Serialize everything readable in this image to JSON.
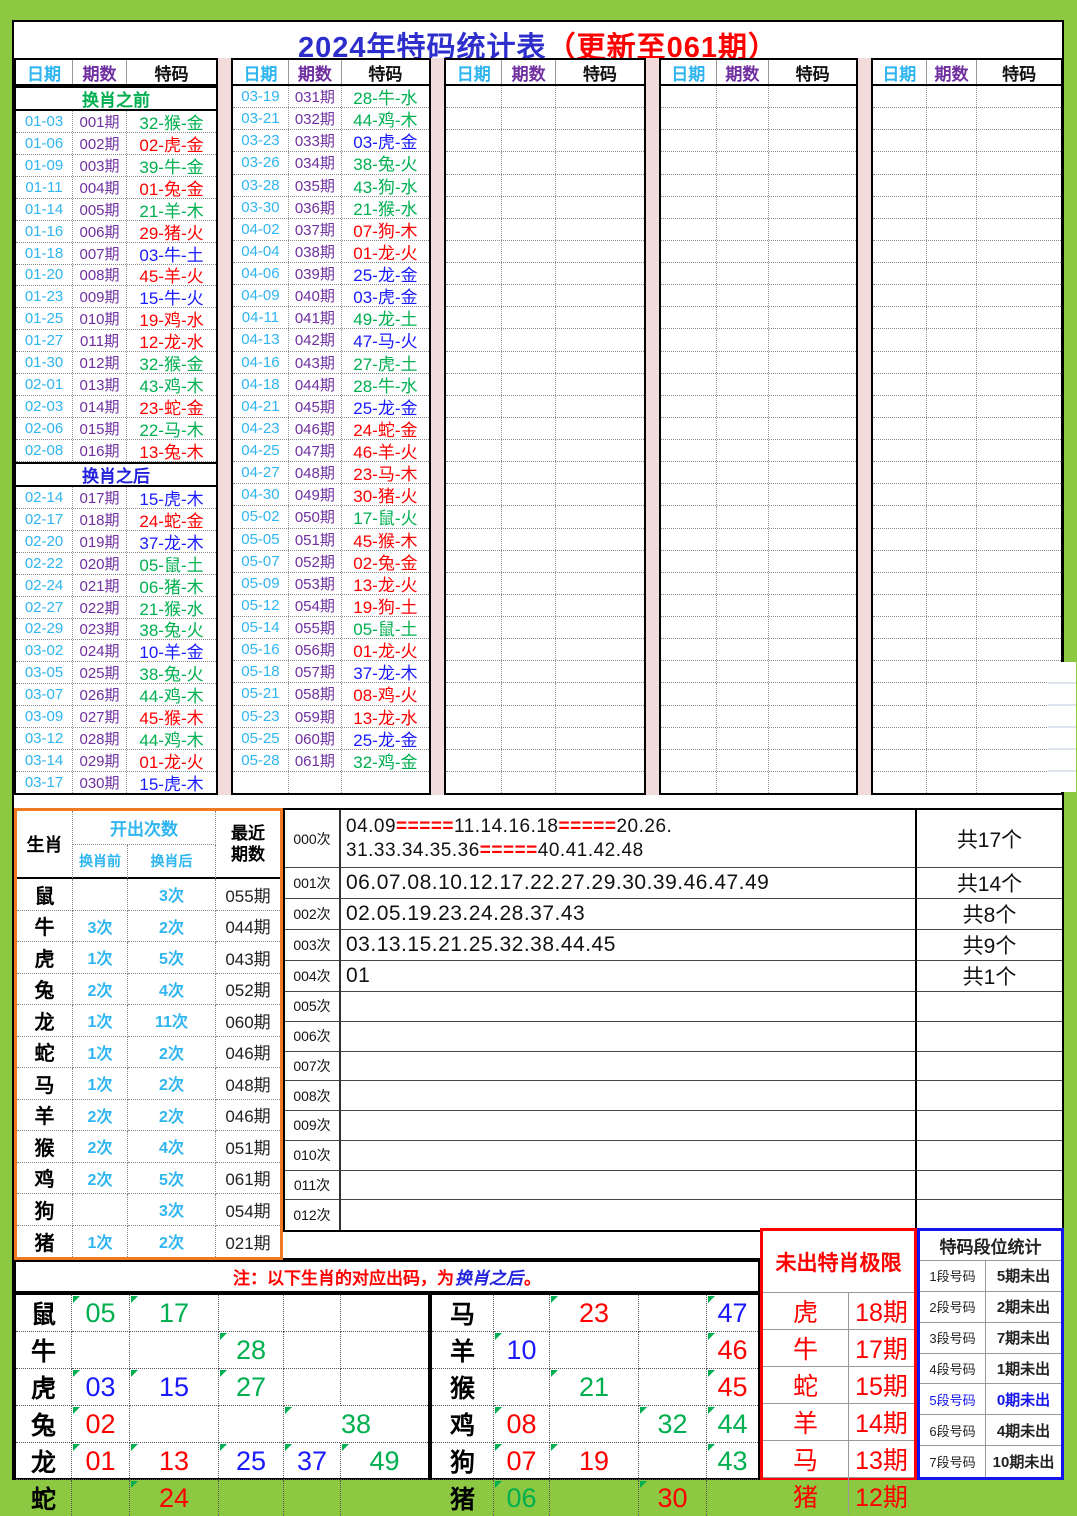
{
  "title": {
    "main": "2024年特码统计表",
    "suffix": "（更新至061期）"
  },
  "wave": {
    "red": [
      "01",
      "02",
      "07",
      "08",
      "12",
      "13",
      "18",
      "19",
      "23",
      "24",
      "29",
      "30",
      "34",
      "35",
      "40",
      "45",
      "46"
    ],
    "blue": [
      "03",
      "04",
      "09",
      "10",
      "14",
      "15",
      "20",
      "25",
      "26",
      "31",
      "36",
      "37",
      "41",
      "42",
      "47",
      "48"
    ],
    "green": [
      "05",
      "06",
      "11",
      "16",
      "17",
      "21",
      "22",
      "27",
      "28",
      "32",
      "33",
      "38",
      "39",
      "43",
      "44",
      "49"
    ]
  },
  "colors": {
    "accent_red": "#FE0000",
    "accent_blue": "#1A1AFF",
    "accent_green": "#00B050",
    "cyan": "#2FB5F0",
    "purple": "#7030A0",
    "orange": "#EE7B22",
    "pink_separator": "#F2DCDB",
    "frame_green": "#8DC843"
  },
  "top_table": {
    "headers": {
      "date": "日期",
      "period": "期数",
      "code": "特码"
    },
    "groups": [
      {
        "rows": [
          {
            "s": "换肖之前",
            "c": "green"
          },
          {
            "d": "01-03",
            "p": "001期",
            "code": "32-猴-金"
          },
          {
            "d": "01-06",
            "p": "002期",
            "code": "02-虎-金"
          },
          {
            "d": "01-09",
            "p": "003期",
            "code": "39-牛-金"
          },
          {
            "d": "01-11",
            "p": "004期",
            "code": "01-兔-金"
          },
          {
            "d": "01-14",
            "p": "005期",
            "code": "21-羊-木"
          },
          {
            "d": "01-16",
            "p": "006期",
            "code": "29-猪-火"
          },
          {
            "d": "01-18",
            "p": "007期",
            "code": "03-牛-土"
          },
          {
            "d": "01-20",
            "p": "008期",
            "code": "45-羊-火"
          },
          {
            "d": "01-23",
            "p": "009期",
            "code": "15-牛-火"
          },
          {
            "d": "01-25",
            "p": "010期",
            "code": "19-鸡-水"
          },
          {
            "d": "01-27",
            "p": "011期",
            "code": "12-龙-水"
          },
          {
            "d": "01-30",
            "p": "012期",
            "code": "32-猴-金"
          },
          {
            "d": "02-01",
            "p": "013期",
            "code": "43-鸡-木"
          },
          {
            "d": "02-03",
            "p": "014期",
            "code": "23-蛇-金"
          },
          {
            "d": "02-06",
            "p": "015期",
            "code": "22-马-木"
          },
          {
            "d": "02-08",
            "p": "016期",
            "code": "13-兔-木"
          },
          {
            "s": "换肖之后",
            "c": "blue"
          },
          {
            "d": "02-14",
            "p": "017期",
            "code": "15-虎-木"
          },
          {
            "d": "02-17",
            "p": "018期",
            "code": "24-蛇-金"
          },
          {
            "d": "02-20",
            "p": "019期",
            "code": "37-龙-木"
          },
          {
            "d": "02-22",
            "p": "020期",
            "code": "05-鼠-土"
          },
          {
            "d": "02-24",
            "p": "021期",
            "code": "06-猪-木"
          },
          {
            "d": "02-27",
            "p": "022期",
            "code": "21-猴-水"
          },
          {
            "d": "02-29",
            "p": "023期",
            "code": "38-兔-火"
          },
          {
            "d": "03-02",
            "p": "024期",
            "code": "10-羊-金"
          },
          {
            "d": "03-05",
            "p": "025期",
            "code": "38-兔-火"
          },
          {
            "d": "03-07",
            "p": "026期",
            "code": "44-鸡-木"
          },
          {
            "d": "03-09",
            "p": "027期",
            "code": "45-猴-木"
          },
          {
            "d": "03-12",
            "p": "028期",
            "code": "44-鸡-木"
          },
          {
            "d": "03-14",
            "p": "029期",
            "code": "01-龙-火"
          },
          {
            "d": "03-17",
            "p": "030期",
            "code": "15-虎-木"
          }
        ]
      },
      {
        "rows": [
          {
            "d": "03-19",
            "p": "031期",
            "code": "28-牛-水"
          },
          {
            "d": "03-21",
            "p": "032期",
            "code": "44-鸡-木"
          },
          {
            "d": "03-23",
            "p": "033期",
            "code": "03-虎-金"
          },
          {
            "d": "03-26",
            "p": "034期",
            "code": "38-兔-火"
          },
          {
            "d": "03-28",
            "p": "035期",
            "code": "43-狗-水"
          },
          {
            "d": "03-30",
            "p": "036期",
            "code": "21-猴-水"
          },
          {
            "d": "04-02",
            "p": "037期",
            "code": "07-狗-木"
          },
          {
            "d": "04-04",
            "p": "038期",
            "code": "01-龙-火"
          },
          {
            "d": "04-06",
            "p": "039期",
            "code": "25-龙-金"
          },
          {
            "d": "04-09",
            "p": "040期",
            "code": "03-虎-金"
          },
          {
            "d": "04-11",
            "p": "041期",
            "code": "49-龙-土"
          },
          {
            "d": "04-13",
            "p": "042期",
            "code": "47-马-火"
          },
          {
            "d": "04-16",
            "p": "043期",
            "code": "27-虎-土"
          },
          {
            "d": "04-18",
            "p": "044期",
            "code": "28-牛-水"
          },
          {
            "d": "04-21",
            "p": "045期",
            "code": "25-龙-金"
          },
          {
            "d": "04-23",
            "p": "046期",
            "code": "24-蛇-金"
          },
          {
            "d": "04-25",
            "p": "047期",
            "code": "46-羊-火"
          },
          {
            "d": "04-27",
            "p": "048期",
            "code": "23-马-木"
          },
          {
            "d": "04-30",
            "p": "049期",
            "code": "30-猪-火"
          },
          {
            "d": "05-02",
            "p": "050期",
            "code": "17-鼠-火"
          },
          {
            "d": "05-05",
            "p": "051期",
            "code": "45-猴-木"
          },
          {
            "d": "05-07",
            "p": "052期",
            "code": "02-兔-金"
          },
          {
            "d": "05-09",
            "p": "053期",
            "code": "13-龙-火"
          },
          {
            "d": "05-12",
            "p": "054期",
            "code": "19-狗-土"
          },
          {
            "d": "05-14",
            "p": "055期",
            "code": "05-鼠-土"
          },
          {
            "d": "05-16",
            "p": "056期",
            "code": "01-龙-火"
          },
          {
            "d": "05-18",
            "p": "057期",
            "code": "37-龙-木"
          },
          {
            "d": "05-21",
            "p": "058期",
            "code": "08-鸡-火"
          },
          {
            "d": "05-23",
            "p": "059期",
            "code": "13-龙-水"
          },
          {
            "d": "05-25",
            "p": "060期",
            "code": "25-龙-金"
          },
          {
            "d": "05-28",
            "p": "061期",
            "code": "32-鸡-金"
          },
          {
            "e": true
          }
        ]
      },
      {
        "empty_rows": 32
      },
      {
        "empty_rows": 32
      },
      {
        "empty_rows": 32
      }
    ]
  },
  "zodiac_summary": {
    "headers": {
      "zodiac": "生肖",
      "count": "开出次数",
      "before": "换肖前",
      "after": "换肖后",
      "recent": "最近\n期数"
    },
    "rows": [
      {
        "zodiac": "鼠",
        "before": "",
        "after": "3次",
        "recent": "055期"
      },
      {
        "zodiac": "牛",
        "before": "3次",
        "after": "2次",
        "recent": "044期"
      },
      {
        "zodiac": "虎",
        "before": "1次",
        "after": "5次",
        "recent": "043期"
      },
      {
        "zodiac": "兔",
        "before": "2次",
        "after": "4次",
        "recent": "052期"
      },
      {
        "zodiac": "龙",
        "before": "1次",
        "after": "11次",
        "recent": "060期"
      },
      {
        "zodiac": "蛇",
        "before": "1次",
        "after": "2次",
        "recent": "046期"
      },
      {
        "zodiac": "马",
        "before": "1次",
        "after": "2次",
        "recent": "048期"
      },
      {
        "zodiac": "羊",
        "before": "2次",
        "after": "2次",
        "recent": "046期"
      },
      {
        "zodiac": "猴",
        "before": "2次",
        "after": "4次",
        "recent": "051期"
      },
      {
        "zodiac": "鸡",
        "before": "2次",
        "after": "5次",
        "recent": "061期"
      },
      {
        "zodiac": "狗",
        "before": "",
        "after": "3次",
        "recent": "054期"
      },
      {
        "zodiac": "猪",
        "before": "1次",
        "after": "2次",
        "recent": "021期"
      }
    ]
  },
  "frequency_table": {
    "rows": [
      {
        "label": "000次",
        "lines": [
          [
            {
              "t": "04.09"
            },
            {
              "t": "=====",
              "r": true
            },
            {
              "t": "11.14.16.18"
            },
            {
              "t": "=====",
              "r": true
            },
            {
              "t": "20.26."
            }
          ],
          [
            {
              "t": "31.33.34.35.36"
            },
            {
              "t": "=====",
              "r": true
            },
            {
              "t": "40.41.42.48"
            }
          ]
        ],
        "count": "共17个"
      },
      {
        "label": "001次",
        "lines": [
          [
            {
              "t": "06.07.08.10.12.17.22.27.29.30.39.46.47.49"
            }
          ]
        ],
        "count": "共14个"
      },
      {
        "label": "002次",
        "lines": [
          [
            {
              "t": "02.05.19.23.24.28.37.43"
            }
          ]
        ],
        "count": "共8个"
      },
      {
        "label": "003次",
        "lines": [
          [
            {
              "t": "03.13.15.21.25.32.38.44.45"
            }
          ]
        ],
        "count": "共9个"
      },
      {
        "label": "004次",
        "lines": [
          [
            {
              "t": "01"
            }
          ]
        ],
        "count": "共1个"
      },
      {
        "label": "005次",
        "lines": [],
        "count": ""
      },
      {
        "label": "006次",
        "lines": [],
        "count": ""
      },
      {
        "label": "007次",
        "lines": [],
        "count": ""
      },
      {
        "label": "008次",
        "lines": [],
        "count": ""
      },
      {
        "label": "009次",
        "lines": [],
        "count": ""
      },
      {
        "label": "010次",
        "lines": [],
        "count": ""
      },
      {
        "label": "011次",
        "lines": [],
        "count": ""
      },
      {
        "label": "012次",
        "lines": [],
        "count": ""
      }
    ]
  },
  "note": {
    "prefix": "注：以下生肖的对应出码，为",
    "em": "换肖之后",
    "suffix": "。"
  },
  "bottom_left": {
    "rows": [
      {
        "zodiac": "鼠",
        "cells": [
          {
            "v": "05"
          },
          {
            "v": "17"
          },
          {
            "v": ""
          },
          {
            "v": ""
          },
          {
            "v": ""
          }
        ]
      },
      {
        "zodiac": "牛",
        "cells": [
          {
            "v": ""
          },
          {
            "v": ""
          },
          {
            "v": "28"
          },
          {
            "v": ""
          },
          {
            "v": ""
          }
        ]
      },
      {
        "zodiac": "虎",
        "cells": [
          {
            "v": "03"
          },
          {
            "v": "15"
          },
          {
            "v": "27"
          },
          {
            "v": ""
          },
          {
            "v": ""
          }
        ]
      },
      {
        "zodiac": "兔",
        "cells": [
          {
            "v": "02"
          },
          {
            "v": ""
          },
          {
            "v": ""
          },
          {
            "v": "38",
            "span": 2
          }
        ]
      },
      {
        "zodiac": "龙",
        "cells": [
          {
            "v": "01"
          },
          {
            "v": "13"
          },
          {
            "v": "25"
          },
          {
            "v": "37"
          },
          {
            "v": "49"
          }
        ]
      },
      {
        "zodiac": "蛇",
        "cells": [
          {
            "v": ""
          },
          {
            "v": "24"
          },
          {
            "v": ""
          },
          {
            "v": ""
          },
          {
            "v": ""
          }
        ]
      }
    ]
  },
  "bottom_right": {
    "rows": [
      {
        "zodiac": "马",
        "cells": [
          {
            "v": ""
          },
          {
            "v": "23"
          },
          {
            "v": ""
          },
          {
            "v": "47"
          }
        ]
      },
      {
        "zodiac": "羊",
        "cells": [
          {
            "v": "10"
          },
          {
            "v": ""
          },
          {
            "v": ""
          },
          {
            "v": "46"
          }
        ]
      },
      {
        "zodiac": "猴",
        "cells": [
          {
            "v": ""
          },
          {
            "v": "21"
          },
          {
            "v": ""
          },
          {
            "v": "45"
          }
        ]
      },
      {
        "zodiac": "鸡",
        "cells": [
          {
            "v": "08"
          },
          {
            "v": ""
          },
          {
            "v": "32"
          },
          {
            "v": "44"
          }
        ]
      },
      {
        "zodiac": "狗",
        "cells": [
          {
            "v": "07"
          },
          {
            "v": "19"
          },
          {
            "v": ""
          },
          {
            "v": "43"
          }
        ]
      },
      {
        "zodiac": "猪",
        "cells": [
          {
            "v": "06"
          },
          {
            "v": ""
          },
          {
            "v": "30"
          },
          {
            "v": ""
          }
        ]
      }
    ]
  },
  "red_limit": {
    "title": "未出特肖极限",
    "rows": [
      {
        "zodiac": "虎",
        "periods": "18期"
      },
      {
        "zodiac": "牛",
        "periods": "17期"
      },
      {
        "zodiac": "蛇",
        "periods": "15期"
      },
      {
        "zodiac": "羊",
        "periods": "14期"
      },
      {
        "zodiac": "马",
        "periods": "13期"
      },
      {
        "zodiac": "猪",
        "periods": "12期"
      }
    ]
  },
  "segment_stats": {
    "title": "特码段位统计",
    "rows": [
      {
        "label": "1段号码",
        "value": "5期未出",
        "highlight": false
      },
      {
        "label": "2段号码",
        "value": "2期未出",
        "highlight": false
      },
      {
        "label": "3段号码",
        "value": "7期未出",
        "highlight": false
      },
      {
        "label": "4段号码",
        "value": "1期未出",
        "highlight": false
      },
      {
        "label": "5段号码",
        "value": "0期未出",
        "highlight": true
      },
      {
        "label": "6段号码",
        "value": "4期未出",
        "highlight": false
      },
      {
        "label": "7段号码",
        "value": "10期未出",
        "highlight": false
      }
    ]
  }
}
